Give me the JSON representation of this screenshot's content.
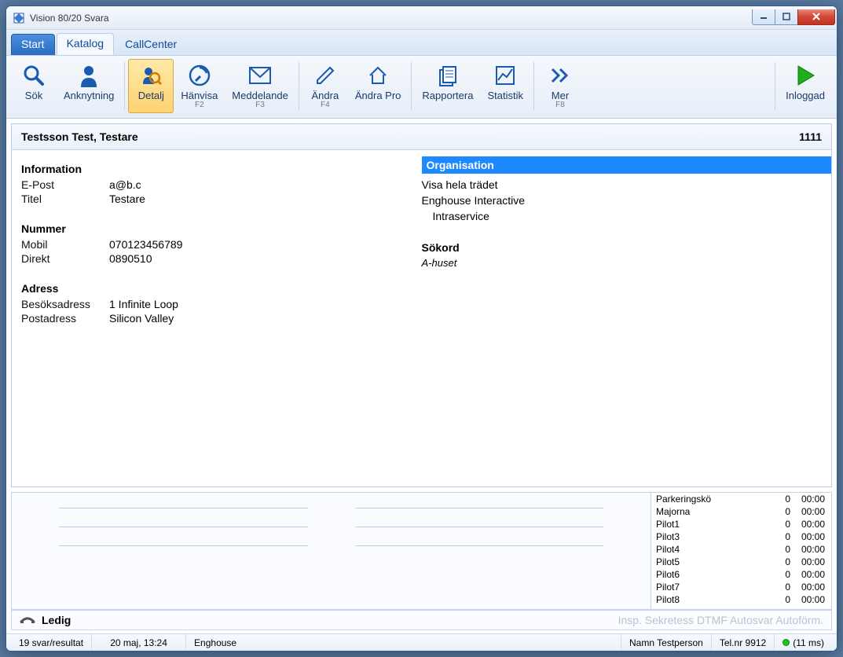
{
  "window": {
    "title": "Vision 80/20 Svara"
  },
  "tabs": {
    "start": "Start",
    "katalog": "Katalog",
    "callcenter": "CallCenter"
  },
  "ribbon": {
    "sok": "Sök",
    "anknytning": "Anknytning",
    "detalj": "Detalj",
    "hanvisa": "Hänvisa",
    "hanvisa_key": "F2",
    "meddelande": "Meddelande",
    "meddelande_key": "F3",
    "andra": "Ändra",
    "andra_key": "F4",
    "andrapro": "Ändra Pro",
    "rapportera": "Rapportera",
    "statistik": "Statistik",
    "mer": "Mer",
    "mer_key": "F8",
    "inloggad": "Inloggad"
  },
  "card": {
    "name": "Testsson Test, Testare",
    "extension": "1111",
    "info_heading": "Information",
    "epost_label": "E-Post",
    "epost": "a@b.c",
    "titel_label": "Titel",
    "titel": "Testare",
    "nummer_heading": "Nummer",
    "mobil_label": "Mobil",
    "mobil": "070123456789",
    "direkt_label": "Direkt",
    "direkt": "0890510",
    "adress_heading": "Adress",
    "besok_label": "Besöksadress",
    "besok": "1 Infinite Loop",
    "post_label": "Postadress",
    "post": "Silicon Valley",
    "org_heading": "Organisation",
    "org_showtree": "Visa hela trädet",
    "org_l1": "Enghouse Interactive",
    "org_l2": "Intraservice",
    "sokord_heading": "Sökord",
    "sokord": "A-huset"
  },
  "queues": [
    {
      "name": "Parkeringskö",
      "count": "0",
      "time": "00:00"
    },
    {
      "name": "Majorna",
      "count": "0",
      "time": "00:00"
    },
    {
      "name": "Pilot1",
      "count": "0",
      "time": "00:00"
    },
    {
      "name": "Pilot3",
      "count": "0",
      "time": "00:00"
    },
    {
      "name": "Pilot4",
      "count": "0",
      "time": "00:00"
    },
    {
      "name": "Pilot5",
      "count": "0",
      "time": "00:00"
    },
    {
      "name": "Pilot6",
      "count": "0",
      "time": "00:00"
    },
    {
      "name": "Pilot7",
      "count": "0",
      "time": "00:00"
    },
    {
      "name": "Pilot8",
      "count": "0",
      "time": "00:00"
    }
  ],
  "callbar": {
    "status": "Ledig",
    "flags": "Insp.  Sekretess  DTMF  Autosvar  Autoförm."
  },
  "statusbar": {
    "results": "19 svar/resultat",
    "datetime": "20 maj, 13:24",
    "org": "Enghouse",
    "user": "Namn Testperson",
    "telnr": "Tel.nr 9912",
    "ping": "(11 ms)"
  }
}
